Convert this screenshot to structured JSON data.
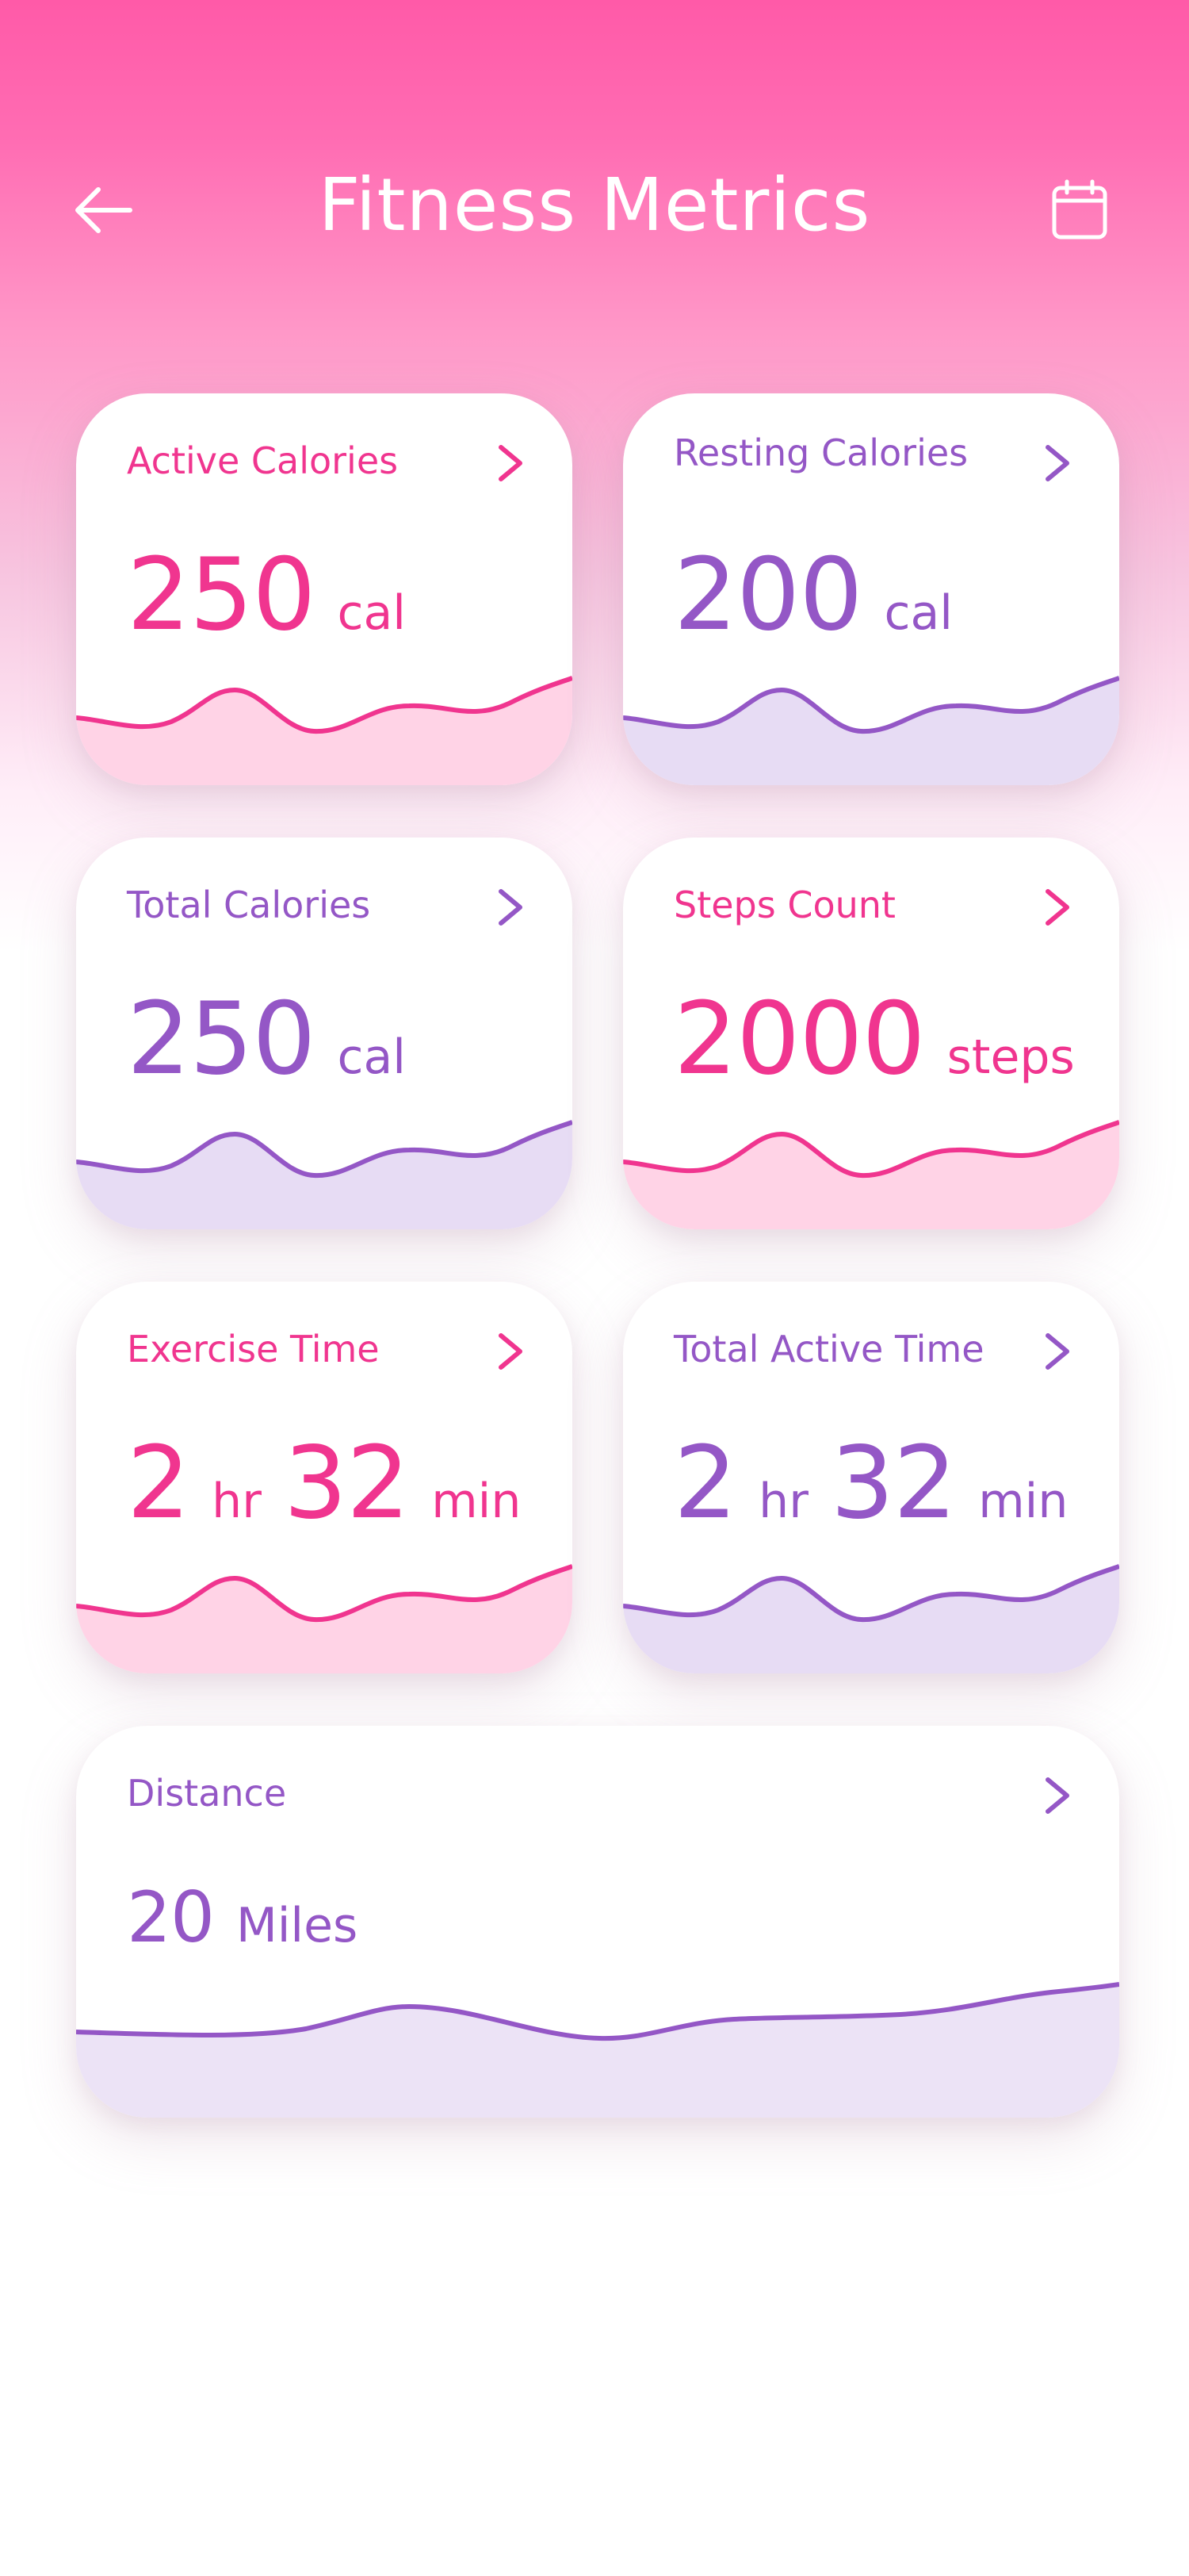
{
  "header": {
    "title": "Fitness Metrics",
    "back_icon": "arrow-left-icon",
    "calendar_icon": "calendar-icon"
  },
  "colors": {
    "pink": "#f0358f",
    "purple": "#9457c6",
    "pink_fill": "#ffd3e6",
    "purple_fill": "#e7dcf4"
  },
  "cards": [
    {
      "label": "Active Calories",
      "value": "250",
      "unit": "cal",
      "color": "pink"
    },
    {
      "label": "Resting Calories",
      "value": "200",
      "unit": "cal",
      "color": "purple"
    },
    {
      "label": "Total Calories",
      "value": "250",
      "unit": "cal",
      "color": "purple"
    },
    {
      "label": "Steps Count",
      "value": "2000",
      "unit": "steps",
      "color": "pink"
    },
    {
      "label": "Exercise Time",
      "hours": "2",
      "hours_unit": "hr",
      "minutes": "32",
      "minutes_unit": "min",
      "color": "pink"
    },
    {
      "label": "Total Active Time",
      "hours": "2",
      "hours_unit": "hr",
      "minutes": "32",
      "minutes_unit": "min",
      "color": "purple"
    },
    {
      "label": "Distance",
      "value": "20",
      "unit": "Miles",
      "color": "purple"
    }
  ]
}
